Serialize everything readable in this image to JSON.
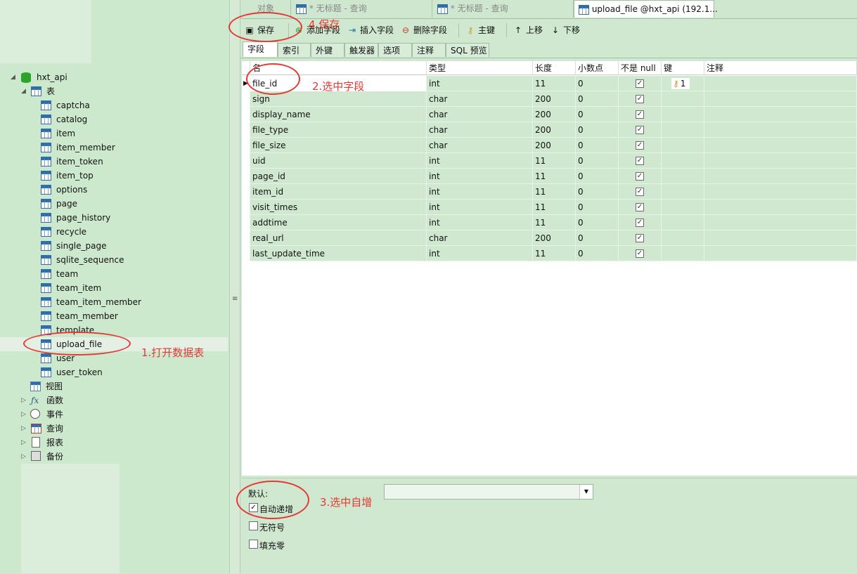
{
  "sidebar": {
    "db_name": "hxt_api",
    "tables_label": "表",
    "tables": [
      "captcha",
      "catalog",
      "item",
      "item_member",
      "item_token",
      "item_top",
      "options",
      "page",
      "page_history",
      "recycle",
      "single_page",
      "sqlite_sequence",
      "team",
      "team_item",
      "team_item_member",
      "team_member",
      "template",
      "upload_file",
      "user",
      "user_token"
    ],
    "views_label": "视图",
    "functions_label": "函数",
    "events_label": "事件",
    "queries_label": "查询",
    "reports_label": "报表",
    "backups_label": "备份"
  },
  "tabs": {
    "objects": "对象",
    "query1": "* 无标题 - 查询",
    "query2": "* 无标题 - 查询",
    "active": "upload_file @hxt_api (192.1..."
  },
  "toolbar": {
    "save": "保存",
    "add_field": "添加字段",
    "insert_field": "插入字段",
    "delete_field": "删除字段",
    "primary_key": "主键",
    "move_up": "上移",
    "move_down": "下移"
  },
  "subtabs": [
    "字段",
    "索引",
    "外键",
    "触发器",
    "选项",
    "注释",
    "SQL 预览"
  ],
  "grid": {
    "headers": [
      "名",
      "类型",
      "长度",
      "小数点",
      "不是 null",
      "键",
      "注释"
    ],
    "rows": [
      {
        "name": "file_id",
        "type": "int",
        "length": "11",
        "decimals": "0",
        "not_null": true,
        "key": "1"
      },
      {
        "name": "sign",
        "type": "char",
        "length": "200",
        "decimals": "0",
        "not_null": true,
        "key": ""
      },
      {
        "name": "display_name",
        "type": "char",
        "length": "200",
        "decimals": "0",
        "not_null": true,
        "key": ""
      },
      {
        "name": "file_type",
        "type": "char",
        "length": "200",
        "decimals": "0",
        "not_null": true,
        "key": ""
      },
      {
        "name": "file_size",
        "type": "char",
        "length": "200",
        "decimals": "0",
        "not_null": true,
        "key": ""
      },
      {
        "name": "uid",
        "type": "int",
        "length": "11",
        "decimals": "0",
        "not_null": true,
        "key": ""
      },
      {
        "name": "page_id",
        "type": "int",
        "length": "11",
        "decimals": "0",
        "not_null": true,
        "key": ""
      },
      {
        "name": "item_id",
        "type": "int",
        "length": "11",
        "decimals": "0",
        "not_null": true,
        "key": ""
      },
      {
        "name": "visit_times",
        "type": "int",
        "length": "11",
        "decimals": "0",
        "not_null": true,
        "key": ""
      },
      {
        "name": "addtime",
        "type": "int",
        "length": "11",
        "decimals": "0",
        "not_null": true,
        "key": ""
      },
      {
        "name": "real_url",
        "type": "char",
        "length": "200",
        "decimals": "0",
        "not_null": true,
        "key": ""
      },
      {
        "name": "last_update_time",
        "type": "int",
        "length": "11",
        "decimals": "0",
        "not_null": true,
        "key": ""
      }
    ]
  },
  "props": {
    "default_label": "默认:",
    "default_value": "",
    "auto_increment_label": "自动递增",
    "auto_increment_checked": true,
    "unsigned_label": "无符号",
    "zerofill_label": "填充零"
  },
  "annotations": {
    "step1": "1.打开数据表",
    "step2": "2.选中字段",
    "step3": "3.选中自增",
    "step4": "4.保存"
  },
  "colors": {
    "background": "#cfe8cf",
    "annotation": "#e53935"
  }
}
